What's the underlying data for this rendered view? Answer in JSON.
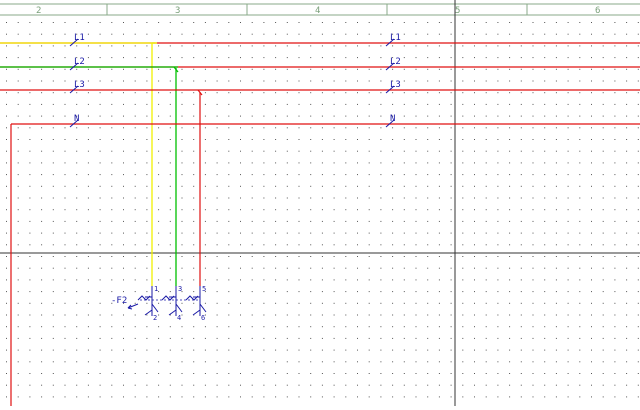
{
  "ruler": {
    "columns": [
      "2",
      "3",
      "4",
      "5",
      "6"
    ]
  },
  "wires": [
    {
      "id": "L1",
      "label": "L1",
      "color": "#f2f200"
    },
    {
      "id": "L2",
      "label": "L2",
      "color": "#00c000"
    },
    {
      "id": "L3",
      "label": "L3",
      "color": "#e01010"
    },
    {
      "id": "N",
      "label": "N",
      "color": "#e01010"
    }
  ],
  "component": {
    "tag": "-F2",
    "terminals": [
      "1",
      "2",
      "3",
      "4",
      "5",
      "6"
    ]
  },
  "colors": {
    "grid_dot": "#555555",
    "ruler_line": "#88aa88",
    "symbol": "#1a1aa6",
    "crosshair": "#333333"
  }
}
